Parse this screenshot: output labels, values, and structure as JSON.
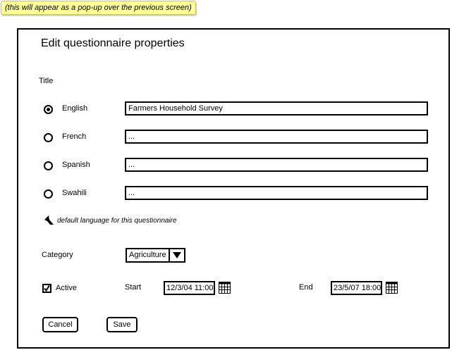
{
  "note": {
    "text": "(this will appear as a pop-up over the previous screen)",
    "color": "#ffff99"
  },
  "dialog": {
    "title": "Edit questionnaire properties"
  },
  "title_section": {
    "label": "Title",
    "languages": [
      {
        "name": "English",
        "value": "Farmers Household Survey",
        "selected": true
      },
      {
        "name": "French",
        "value": "...",
        "selected": false
      },
      {
        "name": "Spanish",
        "value": "...",
        "selected": false
      },
      {
        "name": "Swahili",
        "value": "...",
        "selected": false
      }
    ],
    "hint": {
      "icon": "arrow-up-icon",
      "text": "default language for this questionnaire"
    }
  },
  "category": {
    "label": "Category",
    "selected": "Agriculture",
    "icon": "chevron-down-icon"
  },
  "active": {
    "label": "Active",
    "checked": true,
    "icon": "checkmark-icon"
  },
  "start": {
    "label": "Start",
    "value": "12/3/04 11:00",
    "icon": "calendar-icon"
  },
  "end": {
    "label": "End",
    "value": "23/5/07 18:00",
    "icon": "calendar-icon"
  },
  "buttons": {
    "cancel": "Cancel",
    "save": "Save"
  }
}
